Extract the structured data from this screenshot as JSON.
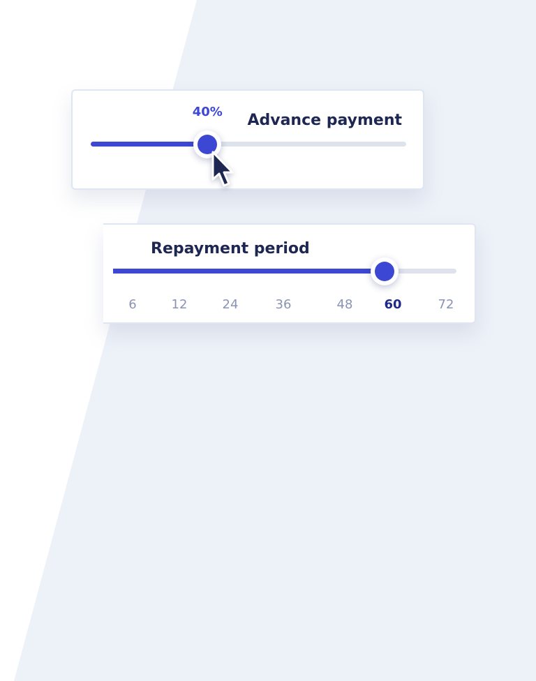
{
  "advance_payment": {
    "title": "Advance payment",
    "value_label": "40%",
    "value_fraction": 0.37
  },
  "repayment_period": {
    "title": "Repayment period",
    "value_fraction": 0.79,
    "ticks": [
      "6",
      "12",
      "24",
      "36",
      "48",
      "60",
      "72"
    ],
    "selected_tick": "60"
  },
  "colors": {
    "accent": "#3c48d3",
    "title_text": "#1e2752",
    "tick_text": "#8a93b4",
    "selected_tick": "#1f2a88",
    "track": "#dde2ec",
    "background": "#edf1f8"
  },
  "icons": {
    "cursor": "arrow-cursor-icon"
  }
}
